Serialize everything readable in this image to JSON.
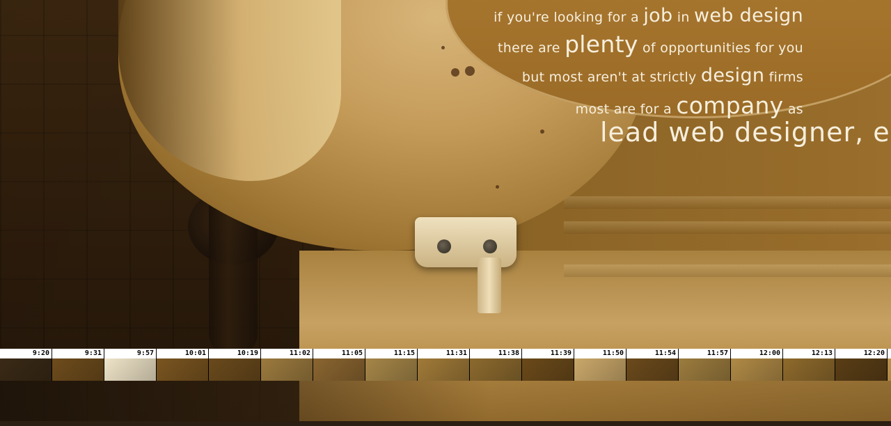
{
  "headline": {
    "line1": {
      "pre": "if you're looking for a ",
      "job": "job",
      "mid": " in ",
      "webdesign": "web design"
    },
    "line2": {
      "pre": "there are ",
      "plenty": "plenty",
      "post": " of opportunities for you"
    },
    "line3": {
      "pre": "but most aren't at strictly ",
      "design": "design",
      "post": " firms"
    },
    "line4": {
      "pre": "most are for a ",
      "company": "company",
      "post": " as"
    },
    "lead": "lead web designer, e"
  },
  "timeline": {
    "times": [
      "9:20",
      "9:31",
      "9:57",
      "10:01",
      "10:19",
      "11:02",
      "11:05",
      "11:15",
      "11:31",
      "11:38",
      "11:39",
      "11:50",
      "11:54",
      "11:57",
      "12:00",
      "12:13",
      "12:20"
    ],
    "thumb_colors": [
      "#3a2a16",
      "#6e4c1c",
      "#efe4c8",
      "#7a5520",
      "#6a4a1c",
      "#9b7a3e",
      "#8a6530",
      "#a58648",
      "#a07a38",
      "#8c6a2e",
      "#6b4a1a",
      "#caa86a",
      "#6b4a1c",
      "#9c7c3e",
      "#b08a46",
      "#8e6a2c",
      "#5a3e16"
    ]
  }
}
